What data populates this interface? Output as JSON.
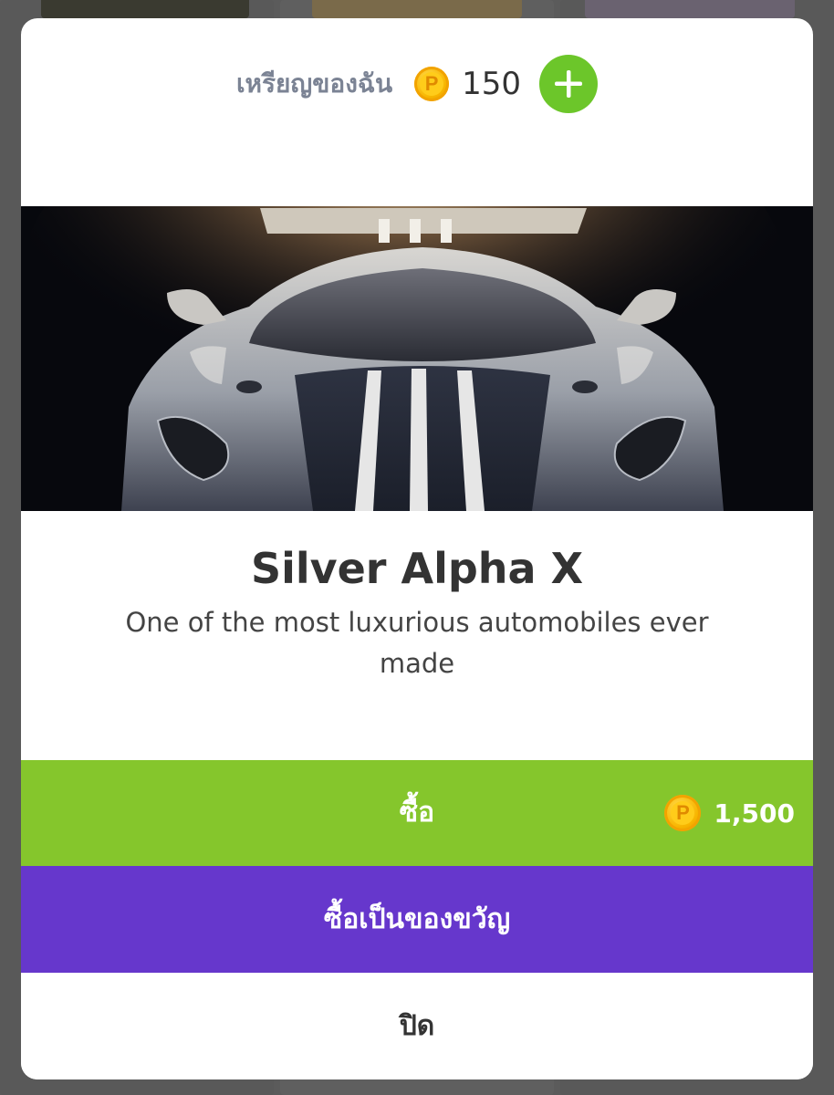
{
  "wallet": {
    "label": "เหรียญของฉัน",
    "balance": "150",
    "coin_icon": "coin-icon",
    "coin_letter": "P",
    "add_icon": "plus-icon"
  },
  "product": {
    "image_icon": "sports-car-image",
    "title": "Silver Alpha X",
    "description": "One of the most luxurious automobiles ever made"
  },
  "actions": {
    "buy_label": "ซื้อ",
    "price": "1,500",
    "gift_label": "ซื้อเป็นของขวัญ",
    "close_label": "ปิด"
  },
  "colors": {
    "buy": "#85c62c",
    "gift": "#6637cc",
    "add": "#6cc62a",
    "coin": "#f7b500"
  }
}
